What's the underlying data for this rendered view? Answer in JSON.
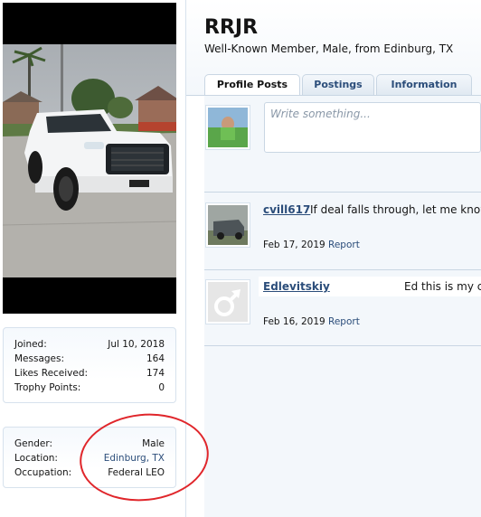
{
  "profile": {
    "username": "RRJR",
    "user_title": "Well-Known Member, Male, from Edinburg, TX"
  },
  "tabs": [
    {
      "label": "Profile Posts",
      "active": true
    },
    {
      "label": "Postings",
      "active": false
    },
    {
      "label": "Information",
      "active": false
    }
  ],
  "stats": {
    "rows": [
      {
        "label": "Joined:",
        "value": "Jul 10, 2018"
      },
      {
        "label": "Messages:",
        "value": "164"
      },
      {
        "label": "Likes Received:",
        "value": "174"
      },
      {
        "label": "Trophy Points:",
        "value": "0"
      }
    ]
  },
  "details": {
    "rows": [
      {
        "label": "Gender:",
        "value": "Male"
      },
      {
        "label": "Location:",
        "value": "Edinburg, TX"
      },
      {
        "label": "Occupation:",
        "value": "Federal LEO"
      }
    ]
  },
  "composer": {
    "placeholder": "Write something..."
  },
  "posts": [
    {
      "author": "cvill617",
      "text": "If deal falls through, let me know",
      "date": "Feb 17, 2019",
      "report": "Report"
    },
    {
      "author": "Edlevitskiy",
      "text": "Ed this is my co",
      "date": "Feb 16, 2019",
      "report": "Report"
    }
  ],
  "colors": {
    "link": "#2b4d7a",
    "annotation": "#e0262b",
    "border": "#c9d6e3"
  }
}
